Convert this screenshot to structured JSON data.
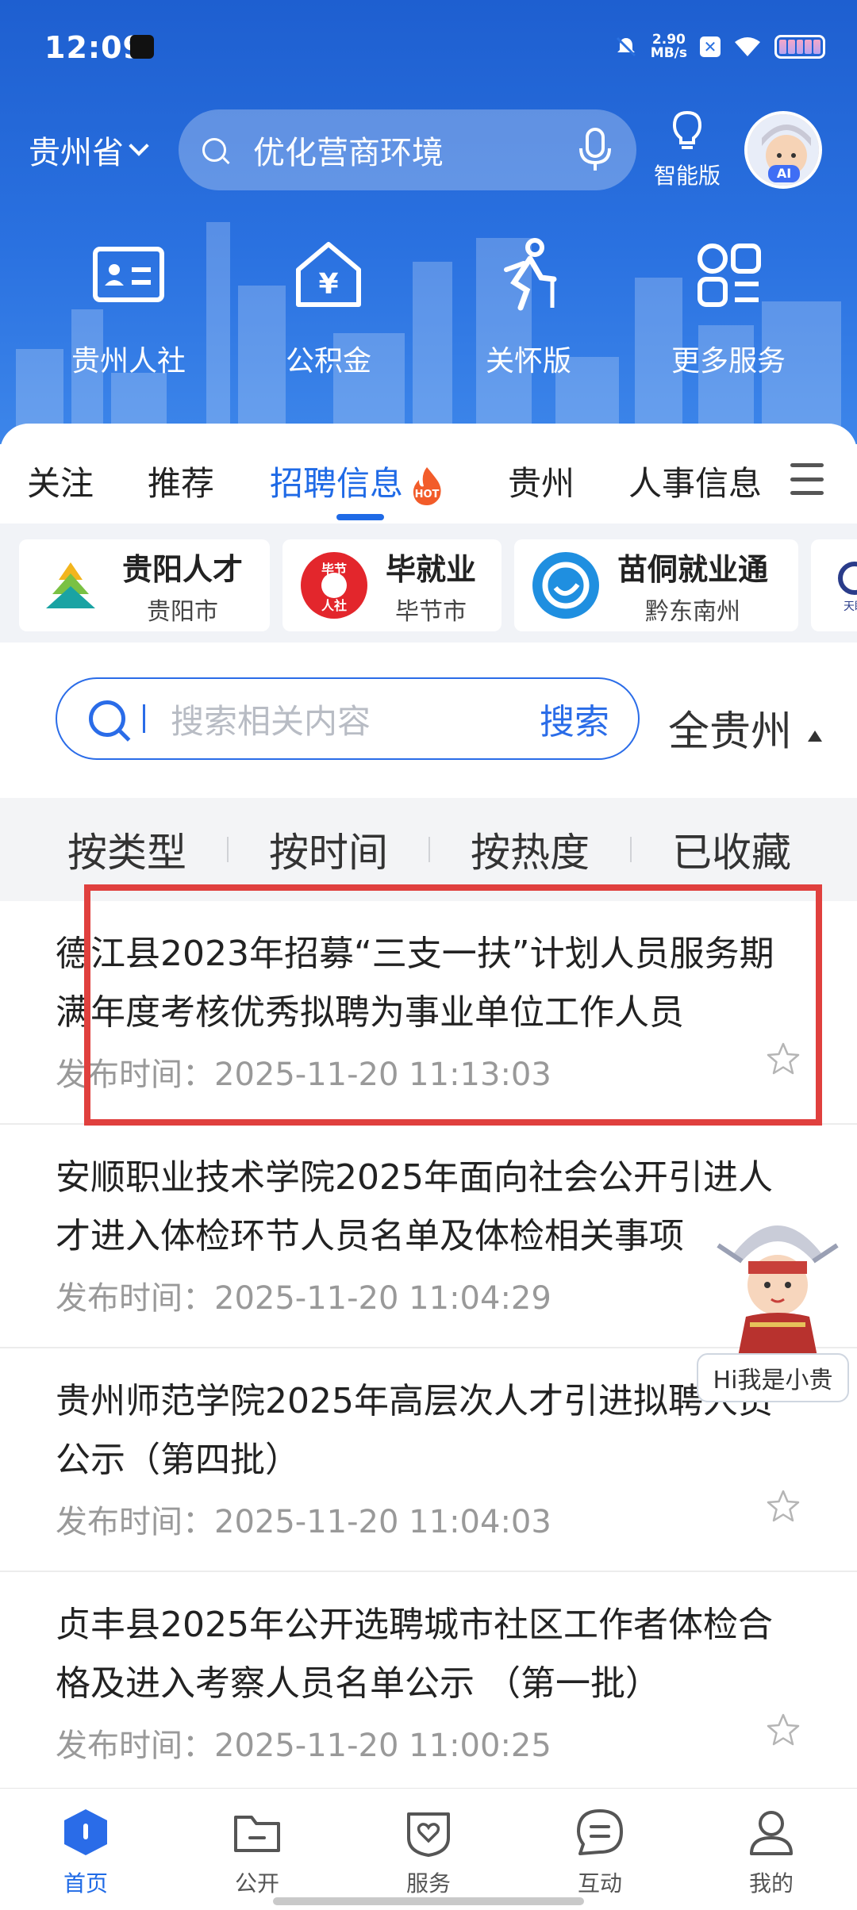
{
  "status_bar": {
    "time": "12:09",
    "speed_value": "2.90",
    "speed_unit": "MB/s"
  },
  "header": {
    "region": "贵州省",
    "search_text": "优化营商环境",
    "smart_label": "智能版",
    "avatar_badge": "AI"
  },
  "quick_actions": [
    {
      "label": "贵州人社",
      "icon": "id-card-icon"
    },
    {
      "label": "公积金",
      "icon": "house-yuan-icon"
    },
    {
      "label": "关怀版",
      "icon": "elderly-care-icon"
    },
    {
      "label": "更多服务",
      "icon": "grid-apps-icon"
    }
  ],
  "tabs": [
    {
      "label": "关注"
    },
    {
      "label": "推荐"
    },
    {
      "label": "招聘信息",
      "active": true,
      "badge": "HOT"
    },
    {
      "label": "贵州"
    },
    {
      "label": "人事信息"
    }
  ],
  "partners": [
    {
      "name": "贵阳人才",
      "city": "贵阳市"
    },
    {
      "name": "毕就业",
      "city": "毕节市",
      "logo_text_top": "毕节",
      "logo_text_bottom": "人社"
    },
    {
      "name": "苗侗就业通",
      "city": "黔东南州"
    },
    {
      "name": "",
      "city": "",
      "logo_text": "天眼"
    }
  ],
  "search": {
    "placeholder": "搜索相关内容",
    "button": "搜索",
    "region": "全贵州"
  },
  "filters": [
    "按类型",
    "按时间",
    "按热度",
    "已收藏"
  ],
  "articles": [
    {
      "title": "德江县2023年招募“三支一扶”计划人员服务期满年度考核优秀拟聘为事业单位工作人员",
      "date": "发布时间：2025-11-20 11:13:03"
    },
    {
      "title": "安顺职业技术学院2025年面向社会公开引进人才进入体检环节人员名单及体检相关事项",
      "date": "发布时间：2025-11-20 11:04:29"
    },
    {
      "title": "贵州师范学院2025年高层次人才引进拟聘人员公示（第四批）",
      "date": "发布时间：2025-11-20 11:04:03"
    },
    {
      "title": "贞丰县2025年公开选聘城市社区工作者体检合格及进入考察人员名单公示 （第一批）",
      "date": "发布时间：2025-11-20 11:00:25"
    }
  ],
  "assistant": {
    "bubble": "Hi我是小贵"
  },
  "bottom_nav": [
    {
      "label": "首页",
      "active": true
    },
    {
      "label": "公开"
    },
    {
      "label": "服务"
    },
    {
      "label": "互动"
    },
    {
      "label": "我的"
    }
  ],
  "colors": {
    "primary": "#1f6ae6",
    "header_bg": "#2a71e0",
    "highlight": "#e0403e"
  }
}
